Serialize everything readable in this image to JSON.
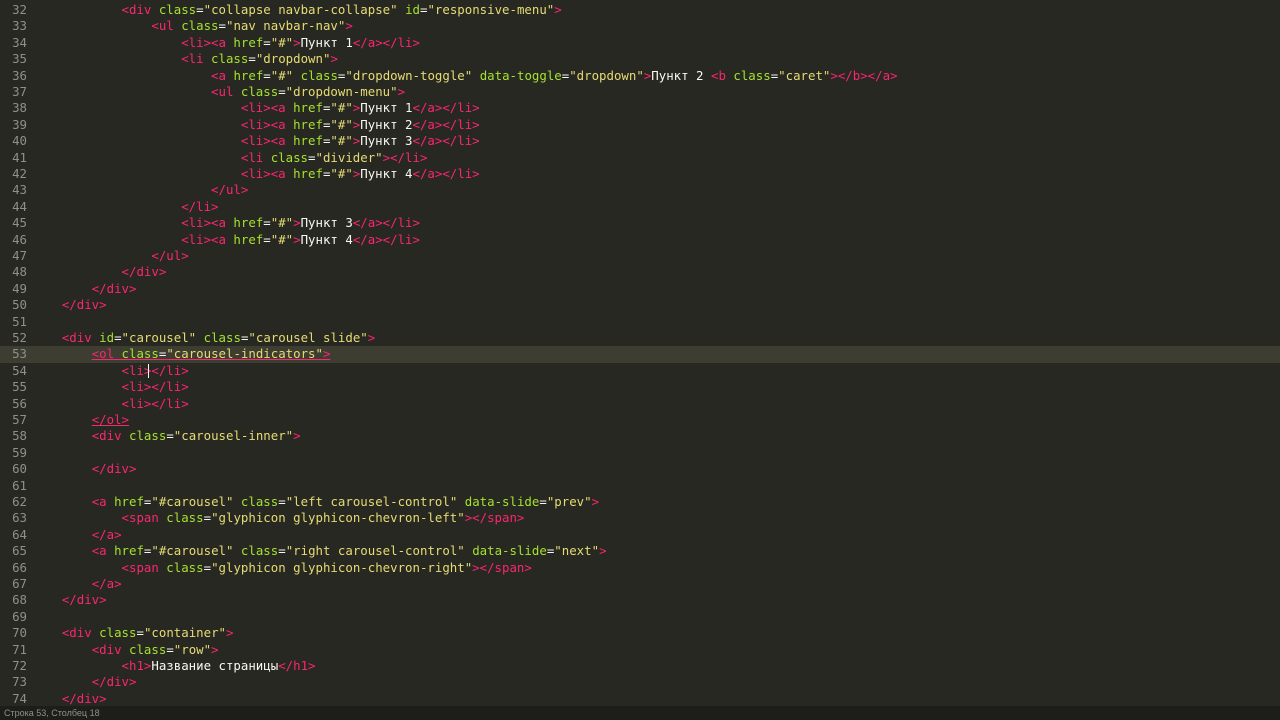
{
  "editor": {
    "indent_unit": "    ",
    "active_line": 53,
    "caret_line": 54,
    "lines": [
      {
        "n": "32",
        "indent": 3,
        "tokens": [
          [
            "tag",
            "<div "
          ],
          [
            "attr",
            "class"
          ],
          [
            "punc",
            "="
          ],
          [
            "str",
            "\"collapse navbar-collapse\""
          ],
          [
            "punc",
            " "
          ],
          [
            "attr",
            "id"
          ],
          [
            "punc",
            "="
          ],
          [
            "str",
            "\"responsive-menu\""
          ],
          [
            "tag",
            ">"
          ]
        ]
      },
      {
        "n": "33",
        "indent": 4,
        "tokens": [
          [
            "tag",
            "<ul "
          ],
          [
            "attr",
            "class"
          ],
          [
            "punc",
            "="
          ],
          [
            "str",
            "\"nav navbar-nav\""
          ],
          [
            "tag",
            ">"
          ]
        ]
      },
      {
        "n": "34",
        "indent": 5,
        "tokens": [
          [
            "tag",
            "<li><a "
          ],
          [
            "attr",
            "href"
          ],
          [
            "punc",
            "="
          ],
          [
            "str",
            "\"#\""
          ],
          [
            "tag",
            ">"
          ],
          [
            "txt",
            "Пункт 1"
          ],
          [
            "tag",
            "</a></li>"
          ]
        ]
      },
      {
        "n": "35",
        "indent": 5,
        "tokens": [
          [
            "tag",
            "<li "
          ],
          [
            "attr",
            "class"
          ],
          [
            "punc",
            "="
          ],
          [
            "str",
            "\"dropdown\""
          ],
          [
            "tag",
            ">"
          ]
        ]
      },
      {
        "n": "36",
        "indent": 6,
        "tokens": [
          [
            "tag",
            "<a "
          ],
          [
            "attr",
            "href"
          ],
          [
            "punc",
            "="
          ],
          [
            "str",
            "\"#\""
          ],
          [
            "punc",
            " "
          ],
          [
            "attr",
            "class"
          ],
          [
            "punc",
            "="
          ],
          [
            "str",
            "\"dropdown-toggle\""
          ],
          [
            "punc",
            " "
          ],
          [
            "attr",
            "data-toggle"
          ],
          [
            "punc",
            "="
          ],
          [
            "str",
            "\"dropdown\""
          ],
          [
            "tag",
            ">"
          ],
          [
            "txt",
            "Пункт 2 "
          ],
          [
            "tag",
            "<b "
          ],
          [
            "attr",
            "class"
          ],
          [
            "punc",
            "="
          ],
          [
            "str",
            "\"caret\""
          ],
          [
            "tag",
            "></b></a>"
          ]
        ]
      },
      {
        "n": "37",
        "indent": 6,
        "tokens": [
          [
            "tag",
            "<ul "
          ],
          [
            "attr",
            "class"
          ],
          [
            "punc",
            "="
          ],
          [
            "str",
            "\"dropdown-menu\""
          ],
          [
            "tag",
            ">"
          ]
        ]
      },
      {
        "n": "38",
        "indent": 7,
        "tokens": [
          [
            "tag",
            "<li><a "
          ],
          [
            "attr",
            "href"
          ],
          [
            "punc",
            "="
          ],
          [
            "str",
            "\"#\""
          ],
          [
            "tag",
            ">"
          ],
          [
            "txt",
            "Пункт 1"
          ],
          [
            "tag",
            "</a></li>"
          ]
        ]
      },
      {
        "n": "39",
        "indent": 7,
        "tokens": [
          [
            "tag",
            "<li><a "
          ],
          [
            "attr",
            "href"
          ],
          [
            "punc",
            "="
          ],
          [
            "str",
            "\"#\""
          ],
          [
            "tag",
            ">"
          ],
          [
            "txt",
            "Пункт 2"
          ],
          [
            "tag",
            "</a></li>"
          ]
        ]
      },
      {
        "n": "40",
        "indent": 7,
        "tokens": [
          [
            "tag",
            "<li><a "
          ],
          [
            "attr",
            "href"
          ],
          [
            "punc",
            "="
          ],
          [
            "str",
            "\"#\""
          ],
          [
            "tag",
            ">"
          ],
          [
            "txt",
            "Пункт 3"
          ],
          [
            "tag",
            "</a></li>"
          ]
        ]
      },
      {
        "n": "41",
        "indent": 7,
        "tokens": [
          [
            "tag",
            "<li "
          ],
          [
            "attr",
            "class"
          ],
          [
            "punc",
            "="
          ],
          [
            "str",
            "\"divider\""
          ],
          [
            "tag",
            "></li>"
          ]
        ]
      },
      {
        "n": "42",
        "indent": 7,
        "tokens": [
          [
            "tag",
            "<li><a "
          ],
          [
            "attr",
            "href"
          ],
          [
            "punc",
            "="
          ],
          [
            "str",
            "\"#\""
          ],
          [
            "tag",
            ">"
          ],
          [
            "txt",
            "Пункт 4"
          ],
          [
            "tag",
            "</a></li>"
          ]
        ]
      },
      {
        "n": "43",
        "indent": 6,
        "tokens": [
          [
            "tag",
            "</ul>"
          ]
        ]
      },
      {
        "n": "44",
        "indent": 5,
        "tokens": [
          [
            "tag",
            "</li>"
          ]
        ]
      },
      {
        "n": "45",
        "indent": 5,
        "tokens": [
          [
            "tag",
            "<li><a "
          ],
          [
            "attr",
            "href"
          ],
          [
            "punc",
            "="
          ],
          [
            "str",
            "\"#\""
          ],
          [
            "tag",
            ">"
          ],
          [
            "txt",
            "Пункт 3"
          ],
          [
            "tag",
            "</a></li>"
          ]
        ]
      },
      {
        "n": "46",
        "indent": 5,
        "tokens": [
          [
            "tag",
            "<li><a "
          ],
          [
            "attr",
            "href"
          ],
          [
            "punc",
            "="
          ],
          [
            "str",
            "\"#\""
          ],
          [
            "tag",
            ">"
          ],
          [
            "txt",
            "Пункт 4"
          ],
          [
            "tag",
            "</a></li>"
          ]
        ]
      },
      {
        "n": "47",
        "indent": 4,
        "tokens": [
          [
            "tag",
            "</ul>"
          ]
        ]
      },
      {
        "n": "48",
        "indent": 3,
        "tokens": [
          [
            "tag",
            "</div>"
          ]
        ]
      },
      {
        "n": "49",
        "indent": 2,
        "tokens": [
          [
            "tag",
            "</div>"
          ]
        ]
      },
      {
        "n": "50",
        "indent": 1,
        "tokens": [
          [
            "tag",
            "</div>"
          ]
        ]
      },
      {
        "n": "51",
        "indent": 0,
        "tokens": []
      },
      {
        "n": "52",
        "indent": 1,
        "tokens": [
          [
            "tag",
            "<div "
          ],
          [
            "attr",
            "id"
          ],
          [
            "punc",
            "="
          ],
          [
            "str",
            "\"carousel\""
          ],
          [
            "punc",
            " "
          ],
          [
            "attr",
            "class"
          ],
          [
            "punc",
            "="
          ],
          [
            "str",
            "\"carousel slide\""
          ],
          [
            "tag",
            ">"
          ]
        ]
      },
      {
        "n": "53",
        "indent": 2,
        "squiggle": true,
        "tokens": [
          [
            "tag",
            "<ol "
          ],
          [
            "attr",
            "class"
          ],
          [
            "punc",
            "="
          ],
          [
            "str",
            "\"carousel-indicators\""
          ],
          [
            "tag",
            ">"
          ]
        ]
      },
      {
        "n": "54",
        "indent": 3,
        "tokens": [
          [
            "tag",
            "<li></li>"
          ]
        ]
      },
      {
        "n": "55",
        "indent": 3,
        "tokens": [
          [
            "tag",
            "<li></li>"
          ]
        ]
      },
      {
        "n": "56",
        "indent": 3,
        "tokens": [
          [
            "tag",
            "<li></li>"
          ]
        ]
      },
      {
        "n": "57",
        "indent": 2,
        "squiggle": true,
        "tokens": [
          [
            "tag",
            "</ol>"
          ]
        ]
      },
      {
        "n": "58",
        "indent": 2,
        "tokens": [
          [
            "tag",
            "<div "
          ],
          [
            "attr",
            "class"
          ],
          [
            "punc",
            "="
          ],
          [
            "str",
            "\"carousel-inner\""
          ],
          [
            "tag",
            ">"
          ]
        ]
      },
      {
        "n": "59",
        "indent": 0,
        "tokens": []
      },
      {
        "n": "60",
        "indent": 2,
        "tokens": [
          [
            "tag",
            "</div>"
          ]
        ]
      },
      {
        "n": "61",
        "indent": 0,
        "tokens": []
      },
      {
        "n": "62",
        "indent": 2,
        "tokens": [
          [
            "tag",
            "<a "
          ],
          [
            "attr",
            "href"
          ],
          [
            "punc",
            "="
          ],
          [
            "str",
            "\"#carousel\""
          ],
          [
            "punc",
            " "
          ],
          [
            "attr",
            "class"
          ],
          [
            "punc",
            "="
          ],
          [
            "str",
            "\"left carousel-control\""
          ],
          [
            "punc",
            " "
          ],
          [
            "attr",
            "data-slide"
          ],
          [
            "punc",
            "="
          ],
          [
            "str",
            "\"prev\""
          ],
          [
            "tag",
            ">"
          ]
        ]
      },
      {
        "n": "63",
        "indent": 3,
        "tokens": [
          [
            "tag",
            "<span "
          ],
          [
            "attr",
            "class"
          ],
          [
            "punc",
            "="
          ],
          [
            "str",
            "\"glyphicon glyphicon-chevron-left\""
          ],
          [
            "tag",
            "></span>"
          ]
        ]
      },
      {
        "n": "64",
        "indent": 2,
        "tokens": [
          [
            "tag",
            "</a>"
          ]
        ]
      },
      {
        "n": "65",
        "indent": 2,
        "tokens": [
          [
            "tag",
            "<a "
          ],
          [
            "attr",
            "href"
          ],
          [
            "punc",
            "="
          ],
          [
            "str",
            "\"#carousel\""
          ],
          [
            "punc",
            " "
          ],
          [
            "attr",
            "class"
          ],
          [
            "punc",
            "="
          ],
          [
            "str",
            "\"right carousel-control\""
          ],
          [
            "punc",
            " "
          ],
          [
            "attr",
            "data-slide"
          ],
          [
            "punc",
            "="
          ],
          [
            "str",
            "\"next\""
          ],
          [
            "tag",
            ">"
          ]
        ]
      },
      {
        "n": "66",
        "indent": 3,
        "tokens": [
          [
            "tag",
            "<span "
          ],
          [
            "attr",
            "class"
          ],
          [
            "punc",
            "="
          ],
          [
            "str",
            "\"glyphicon glyphicon-chevron-right\""
          ],
          [
            "tag",
            "></span>"
          ]
        ]
      },
      {
        "n": "67",
        "indent": 2,
        "tokens": [
          [
            "tag",
            "</a>"
          ]
        ]
      },
      {
        "n": "68",
        "indent": 1,
        "tokens": [
          [
            "tag",
            "</div>"
          ]
        ]
      },
      {
        "n": "69",
        "indent": 0,
        "tokens": []
      },
      {
        "n": "70",
        "indent": 1,
        "tokens": [
          [
            "tag",
            "<div "
          ],
          [
            "attr",
            "class"
          ],
          [
            "punc",
            "="
          ],
          [
            "str",
            "\"container\""
          ],
          [
            "tag",
            ">"
          ]
        ]
      },
      {
        "n": "71",
        "indent": 2,
        "tokens": [
          [
            "tag",
            "<div "
          ],
          [
            "attr",
            "class"
          ],
          [
            "punc",
            "="
          ],
          [
            "str",
            "\"row\""
          ],
          [
            "tag",
            ">"
          ]
        ]
      },
      {
        "n": "72",
        "indent": 3,
        "tokens": [
          [
            "tag",
            "<h1>"
          ],
          [
            "txt",
            "Название страницы"
          ],
          [
            "tag",
            "</h1>"
          ]
        ]
      },
      {
        "n": "73",
        "indent": 2,
        "tokens": [
          [
            "tag",
            "</div>"
          ]
        ]
      },
      {
        "n": "74",
        "indent": 1,
        "tokens": [
          [
            "tag",
            "</div>"
          ]
        ]
      }
    ]
  },
  "colors": {
    "background": "#272822",
    "tag": "#f92672",
    "attribute": "#a6e22e",
    "string": "#e6db74",
    "text": "#f8f8f2",
    "gutter": "#8f908a",
    "active_line": "#3e3d32"
  },
  "statusbar": {
    "left": "Строка 53, Столбец 18",
    "right": ""
  }
}
